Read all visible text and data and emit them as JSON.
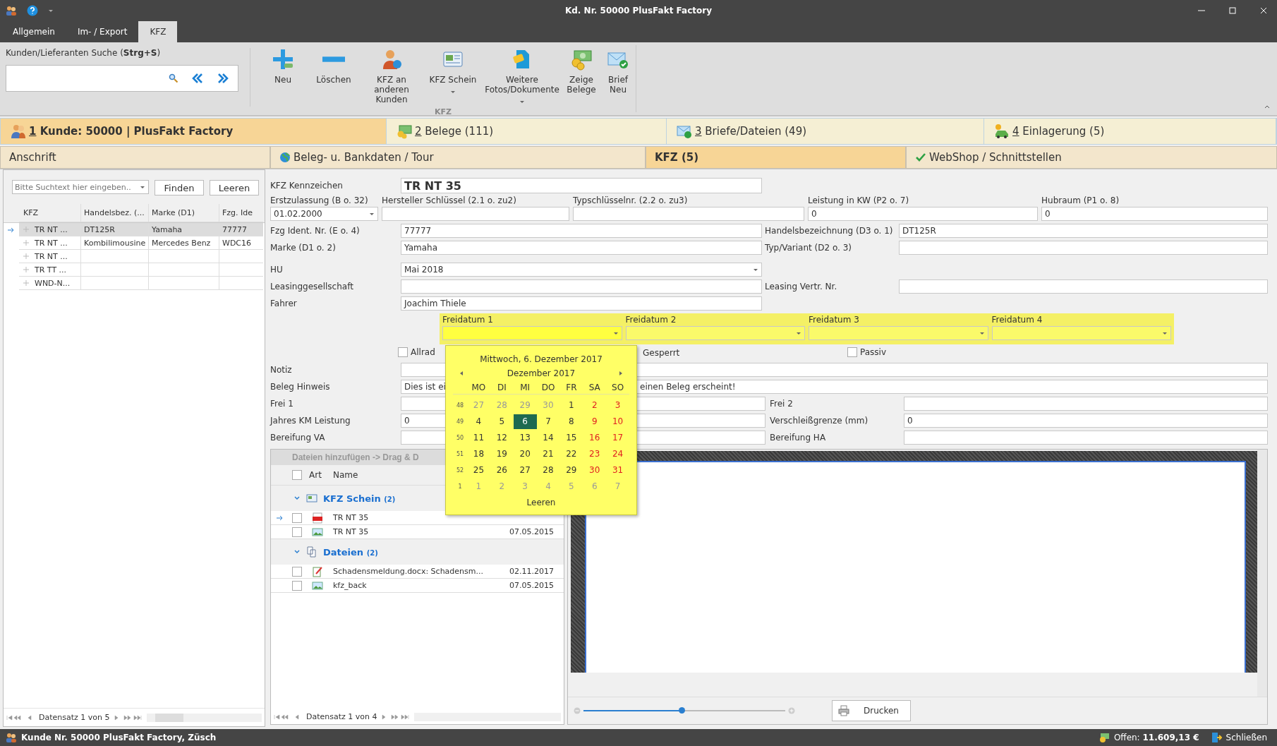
{
  "window": {
    "title": "Kd. Nr. 50000 PlusFakt Factory"
  },
  "ribbon_tabs": [
    {
      "label": "Allgemein",
      "selected": false
    },
    {
      "label": "Im- / Export",
      "selected": false
    },
    {
      "label": "KFZ",
      "selected": true
    }
  ],
  "search": {
    "label": "Kunden/Lieferanten Suche (**Strg+S**)"
  },
  "ribbon_group": {
    "title": "KFZ",
    "buttons": [
      {
        "label": "Neu",
        "kind": "plus",
        "dropdown": false
      },
      {
        "label": "Löschen",
        "kind": "minus",
        "dropdown": false
      },
      {
        "label": "KFZ an anderen Kunden",
        "kind": "person",
        "dropdown": false
      },
      {
        "label": "KFZ Schein",
        "kind": "card",
        "dropdown": true
      },
      {
        "label": "Weitere Fotos/Dokumente",
        "kind": "doc",
        "dropdown": true
      },
      {
        "label": "Zeige Belege",
        "kind": "money",
        "dropdown": false
      },
      {
        "label": "Brief Neu",
        "kind": "mail",
        "dropdown": false
      }
    ]
  },
  "main_tabs": [
    {
      "number": "1",
      "label": "Kunde: 50000 | PlusFakt Factory",
      "kind": "customer",
      "selected": true
    },
    {
      "number": "2",
      "label": "Belege (111)",
      "kind": "money",
      "selected": false
    },
    {
      "number": "3",
      "label": "Briefe/Dateien (49)",
      "kind": "mail",
      "selected": false
    },
    {
      "number": "4",
      "label": "Einlagerung (5)",
      "kind": "car",
      "selected": false
    }
  ],
  "sub_tabs": [
    {
      "label": "Anschrift",
      "kind": "plain",
      "selected": false
    },
    {
      "label": "Beleg- u. Bankdaten / Tour",
      "kind": "globe",
      "selected": false
    },
    {
      "label": "KFZ (5)",
      "kind": "plain",
      "selected": true
    },
    {
      "label": "WebShop / Schnittstellen",
      "kind": "check",
      "selected": false
    }
  ],
  "vehicle_list": {
    "search_placeholder": "Bitte Suchtext hier eingeben..",
    "buttons": [
      "Finden",
      "Leeren"
    ],
    "columns": [
      "KFZ",
      "Handelsbez. (...",
      "Marke (D1)",
      "Fzg. Ide"
    ],
    "rows": [
      {
        "cells": [
          "TR NT ...",
          "DT125R",
          "Yamaha",
          "77777"
        ],
        "selected": true
      },
      {
        "cells": [
          "TR NT ...",
          "Kombilimousine",
          "Mercedes Benz",
          "WDC16"
        ],
        "selected": false
      },
      {
        "cells": [
          "TR NT ...",
          "",
          "",
          ""
        ],
        "selected": false
      },
      {
        "cells": [
          "TR TT ...",
          "",
          "",
          ""
        ],
        "selected": false
      },
      {
        "cells": [
          "WND-N...",
          "",
          "",
          ""
        ],
        "selected": false
      }
    ],
    "pager": "Datensatz 1 von 5"
  },
  "form": {
    "kennzeichen": {
      "label": "KFZ Kennzeichen",
      "value": "TR NT 35"
    },
    "top_fields": [
      {
        "label": "Erstzulassung (B o. 32)",
        "value": "01.02.2000",
        "kind": "combo"
      },
      {
        "label": "Hersteller Schlüssel (2.1 o. zu2)",
        "kind": "text"
      },
      {
        "label": "Typschlüsselnr. (2.2 o. zu3)",
        "kind": "text"
      },
      {
        "label": "Leistung in KW (P2 o. 7)",
        "value": "0",
        "kind": "text"
      },
      {
        "label": "Hubraum (P1 o. 8)",
        "value": "0",
        "kind": "text"
      }
    ],
    "rows_a": [
      {
        "left": {
          "label": "Fzg Ident. Nr. (E o. 4)",
          "value": "77777",
          "kind": "text"
        },
        "right": {
          "label": "Handelsbezeichnung (D3 o. 1)",
          "value": "DT125R"
        }
      },
      {
        "left": {
          "label": "Marke (D1 o. 2)",
          "value": "Yamaha",
          "kind": "text"
        },
        "right": {
          "label": "Typ/Variant (D2 o. 3)"
        }
      },
      {
        "left": {
          "label": "HU",
          "value": "Mai 2018",
          "kind": "combo"
        }
      },
      {
        "left": {
          "label": "Leasinggesellschaft",
          "kind": "text"
        },
        "right": {
          "label": "Leasing Vertr. Nr."
        }
      },
      {
        "left": {
          "label": "Fahrer",
          "value": "Joachim Thiele",
          "kind": "text"
        }
      }
    ],
    "free_dates": [
      {
        "label": "Freidatum 1",
        "open": true
      },
      {
        "label": "Freidatum 2",
        "open": false
      },
      {
        "label": "Freidatum 3",
        "open": false
      },
      {
        "label": "Freidatum 4",
        "open": false
      }
    ],
    "allrad": {
      "label": "Allrad",
      "checked": false
    },
    "gesperrt_label": "Gesperrt",
    "passiv": {
      "label": "Passiv",
      "checked": false
    },
    "notiz": {
      "label": "Notiz"
    },
    "beleg_hinweis": {
      "label": "Beleg Hinweis",
      "value_start": "Dies ist ei",
      "value_end": "einen Beleg erscheint!"
    },
    "rows_b": [
      {
        "left": {
          "label": "Frei 1"
        },
        "right": {
          "label": "Frei 2"
        }
      },
      {
        "left": {
          "label": "Jahres KM Leistung",
          "value": "0"
        },
        "right": {
          "label": "Verschleißgrenze (mm)",
          "value": "0"
        }
      },
      {
        "left": {
          "label": "Bereifung VA"
        },
        "right": {
          "label": "Bereifung HA"
        }
      }
    ]
  },
  "files": {
    "drop_hint": "Dateien hinzufügen -> Drag & D",
    "select_all_checked": false,
    "columns": [
      "Art",
      "Name"
    ],
    "groups": [
      {
        "title": "KFZ Schein",
        "count": "(2)",
        "kind": "card",
        "expanded": true,
        "files": [
          {
            "name": "TR NT 35",
            "kind": "pdf",
            "checked": false,
            "selected": true
          },
          {
            "name": "TR NT 35",
            "date": "07.05.2015",
            "kind": "image",
            "checked": false,
            "selected": false
          }
        ]
      },
      {
        "title": "Dateien",
        "count": "(2)",
        "kind": "copy",
        "expanded": true,
        "files": [
          {
            "name": "Schadensmeldung.docx: Schadensm...",
            "date": "02.11.2017",
            "kind": "edit",
            "checked": false,
            "selected": false
          },
          {
            "name": "kfz_back",
            "date": "07.05.2015",
            "kind": "image",
            "checked": false,
            "selected": false
          }
        ]
      }
    ],
    "pager": "Datensatz 1 von 4"
  },
  "preview": {
    "zoom": {
      "level": 0.49
    },
    "print_button": "Drucken"
  },
  "calendar": {
    "date_line": "Mittwoch, 6. Dezember 2017",
    "month": "Dezember 2017",
    "weekdays": [
      "MO",
      "DI",
      "MI",
      "DO",
      "FR",
      "SA",
      "SO"
    ],
    "weeks": [
      {
        "number": "48",
        "days": [
          {
            "t": "27",
            "kind": "other"
          },
          {
            "t": "28",
            "kind": "other"
          },
          {
            "t": "29",
            "kind": "other"
          },
          {
            "t": "30",
            "kind": "other"
          },
          {
            "t": "1",
            "kind": "day"
          },
          {
            "t": "2",
            "kind": "weekend"
          },
          {
            "t": "3",
            "kind": "weekend"
          }
        ]
      },
      {
        "number": "49",
        "days": [
          {
            "t": "4",
            "kind": "day"
          },
          {
            "t": "5",
            "kind": "day"
          },
          {
            "t": "6",
            "kind": "selected"
          },
          {
            "t": "7",
            "kind": "day"
          },
          {
            "t": "8",
            "kind": "day"
          },
          {
            "t": "9",
            "kind": "weekend"
          },
          {
            "t": "10",
            "kind": "weekend"
          }
        ]
      },
      {
        "number": "50",
        "days": [
          {
            "t": "11",
            "kind": "day"
          },
          {
            "t": "12",
            "kind": "day"
          },
          {
            "t": "13",
            "kind": "day"
          },
          {
            "t": "14",
            "kind": "day"
          },
          {
            "t": "15",
            "kind": "day"
          },
          {
            "t": "16",
            "kind": "weekend"
          },
          {
            "t": "17",
            "kind": "weekend"
          }
        ]
      },
      {
        "number": "51",
        "days": [
          {
            "t": "18",
            "kind": "day"
          },
          {
            "t": "19",
            "kind": "day"
          },
          {
            "t": "20",
            "kind": "day"
          },
          {
            "t": "21",
            "kind": "day"
          },
          {
            "t": "22",
            "kind": "day"
          },
          {
            "t": "23",
            "kind": "weekend"
          },
          {
            "t": "24",
            "kind": "weekend"
          }
        ]
      },
      {
        "number": "52",
        "days": [
          {
            "t": "25",
            "kind": "day"
          },
          {
            "t": "26",
            "kind": "day"
          },
          {
            "t": "27",
            "kind": "day"
          },
          {
            "t": "28",
            "kind": "day"
          },
          {
            "t": "29",
            "kind": "day"
          },
          {
            "t": "30",
            "kind": "weekend"
          },
          {
            "t": "31",
            "kind": "weekend"
          }
        ]
      },
      {
        "number": "1",
        "days": [
          {
            "t": "1",
            "kind": "other"
          },
          {
            "t": "2",
            "kind": "other"
          },
          {
            "t": "3",
            "kind": "other"
          },
          {
            "t": "4",
            "kind": "other"
          },
          {
            "t": "5",
            "kind": "other"
          },
          {
            "t": "6",
            "kind": "other"
          },
          {
            "t": "7",
            "kind": "other"
          }
        ]
      }
    ],
    "clear": "Leeren"
  },
  "status_bar": {
    "customer": "Kunde Nr. 50000 PlusFakt Factory, Züsch",
    "open_label": "Offen:",
    "open_amount": "11.609,13 €",
    "close": "Schließen"
  }
}
